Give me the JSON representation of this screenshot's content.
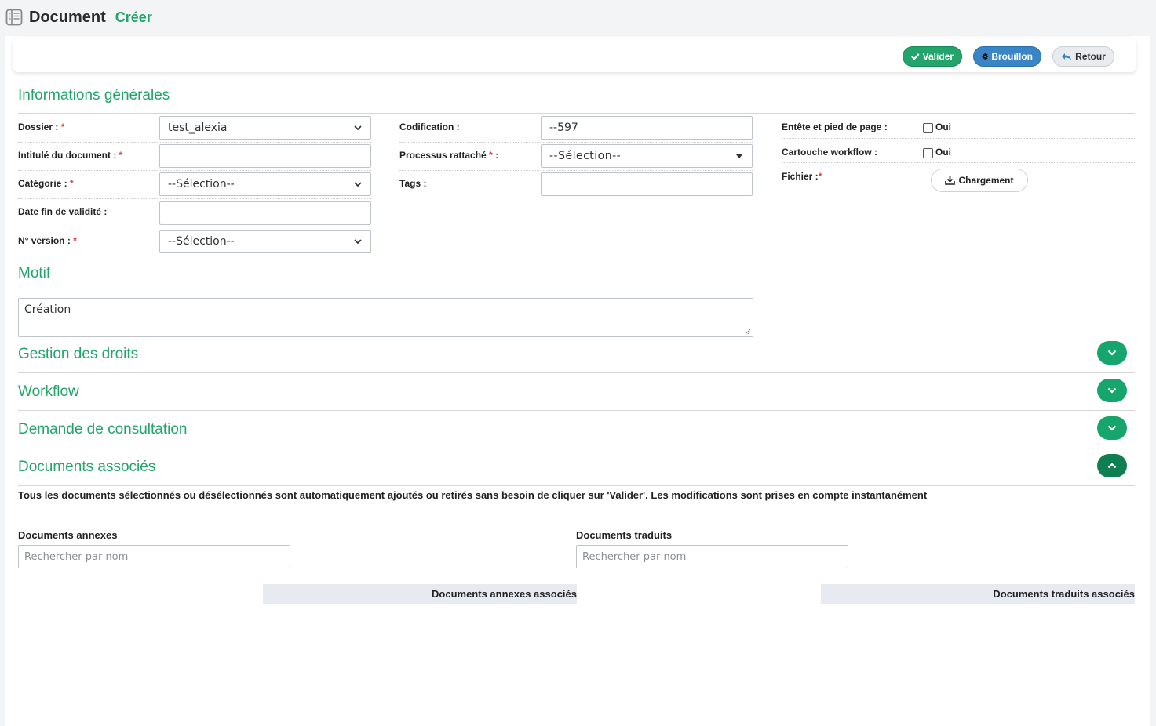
{
  "header": {
    "title": "Document",
    "subtitle": "Créer",
    "icon": "book-icon"
  },
  "toolbar": {
    "valider": "Valider",
    "brouillon": "Brouillon",
    "retour": "Retour"
  },
  "sections": {
    "info": "Informations générales",
    "motif": "Motif",
    "droits": "Gestion des droits",
    "workflow": "Workflow",
    "consultation": "Demande de consultation",
    "associes": "Documents associés"
  },
  "form": {
    "dossier": {
      "label": "Dossier :",
      "value": "test_alexia"
    },
    "intitule": {
      "label": "Intitulé du document :",
      "value": ""
    },
    "categorie": {
      "label": "Catégorie :",
      "value": "--Sélection--"
    },
    "date_fin": {
      "label": "Date fin de validité :",
      "value": ""
    },
    "version": {
      "label": "N° version :",
      "value": "--Sélection--"
    },
    "codification": {
      "label": "Codification :",
      "value": "--597"
    },
    "processus": {
      "label": "Processus rattaché",
      "colon": ":",
      "value": "--Sélection--"
    },
    "tags": {
      "label": "Tags :",
      "value": ""
    },
    "entete": {
      "label": "Entête et pied de page :",
      "option": "Oui",
      "checked": false
    },
    "cartouche": {
      "label": "Cartouche workflow :",
      "option": "Oui",
      "checked": false
    },
    "fichier": {
      "label": "Fichier :",
      "button": "Chargement"
    },
    "required_mark": "*"
  },
  "motif": {
    "value": "Création"
  },
  "associes": {
    "notice": "Tous les documents sélectionnés ou désélectionnés sont automatiquement ajoutés ou retirés sans besoin de cliquer sur 'Valider'. Les modifications sont prises en compte instantanément",
    "annexes_label": "Documents annexes",
    "traduits_label": "Documents traduits",
    "search_placeholder": "Rechercher par nom",
    "annexes_table_header": "Documents annexes associés",
    "traduits_table_header": "Documents traduits associés"
  },
  "colors": {
    "accent": "#23a46b",
    "primary": "#3a85c6",
    "toggle": "#16a56d",
    "required": "#e23b3b"
  }
}
